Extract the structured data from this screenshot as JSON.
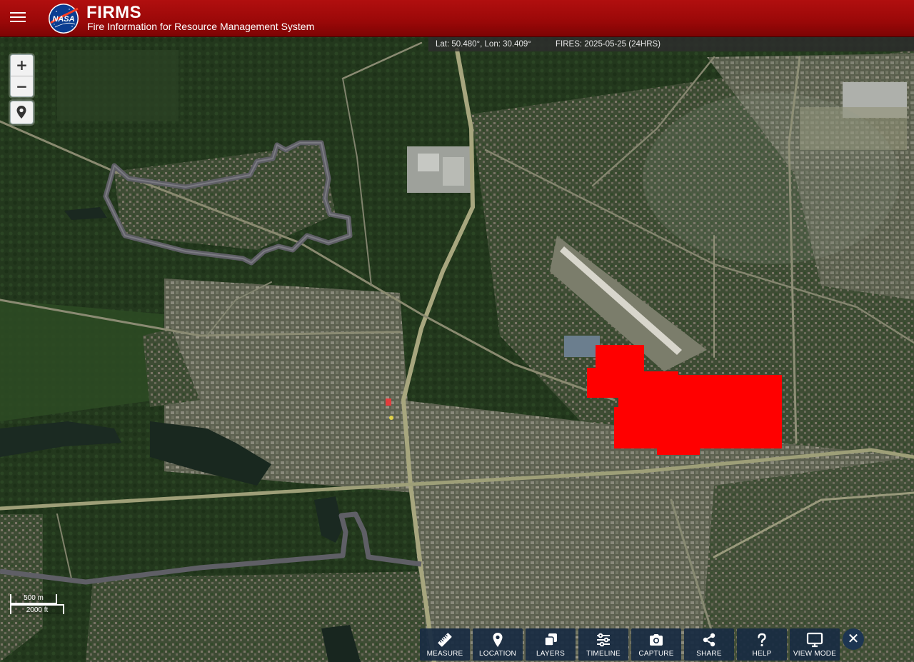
{
  "header": {
    "title": "FIRMS",
    "subtitle": "Fire Information for Resource Management System",
    "logo_text": "NASA",
    "background_color": "#a00a0a"
  },
  "status_bar": {
    "coordinates": "Lat: 50.480°, Lon: 30.409°",
    "fires": "FIRES: 2025-05-25 (24HRS)"
  },
  "map_controls": {
    "zoom_in": "+",
    "zoom_out": "−",
    "locate_icon": "map-pin-icon"
  },
  "scale": {
    "metric": "500 m",
    "imperial": "2000 ft"
  },
  "toolbar": {
    "items": [
      {
        "label": "MEASURE",
        "icon": "ruler-icon"
      },
      {
        "label": "LOCATION",
        "icon": "map-pin-icon"
      },
      {
        "label": "LAYERS",
        "icon": "layers-icon"
      },
      {
        "label": "TIMELINE",
        "icon": "sliders-icon"
      },
      {
        "label": "CAPTURE",
        "icon": "camera-icon"
      },
      {
        "label": "SHARE",
        "icon": "share-icon"
      },
      {
        "label": "HELP",
        "icon": "question-icon"
      },
      {
        "label": "VIEW MODE",
        "icon": "monitor-icon"
      }
    ],
    "close": "✕",
    "background_color": "#182b42"
  },
  "map": {
    "fire_color": "#ff0000",
    "boundary_color": "#5f5f66"
  }
}
